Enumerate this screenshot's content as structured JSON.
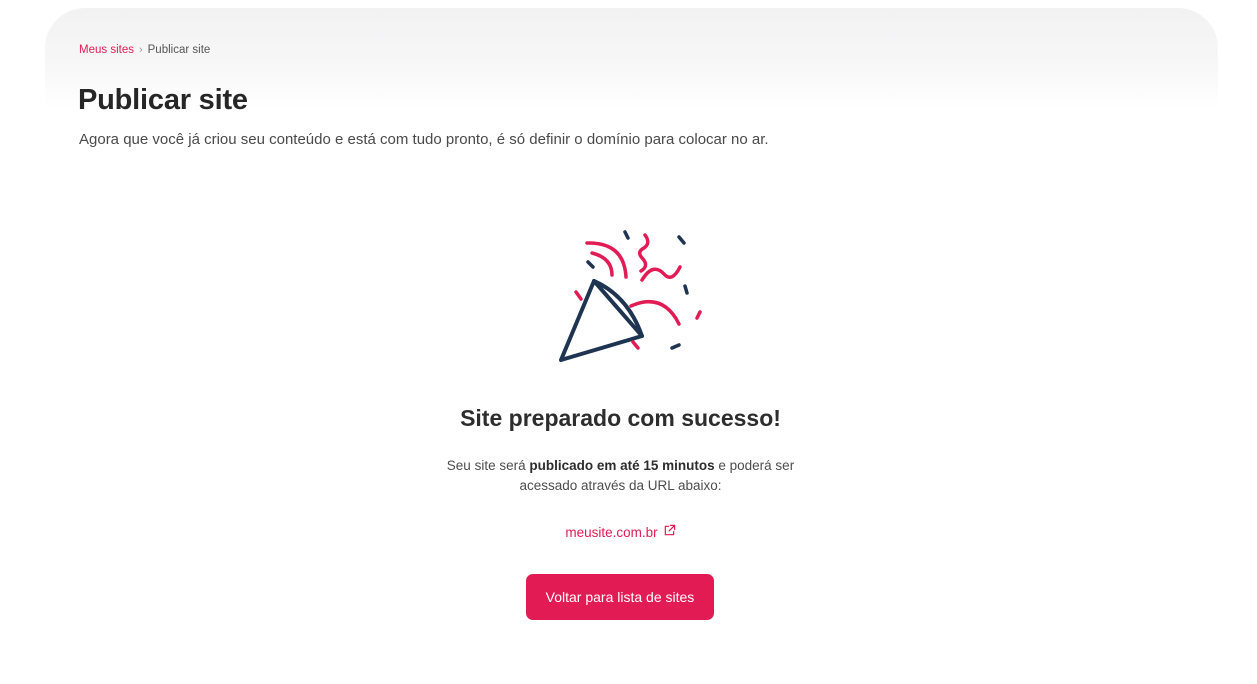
{
  "breadcrumb": {
    "parent": "Meus sites",
    "separator": "›",
    "current": "Publicar site"
  },
  "page": {
    "title": "Publicar site",
    "subtitle": "Agora que você já criou seu conteúdo e está com tudo pronto, é só definir o domínio para colocar no ar."
  },
  "illustration": {
    "icon": "party-popper-icon",
    "colors": {
      "primary": "#e31b54",
      "outline": "#1f3450"
    }
  },
  "success": {
    "title": "Site preparado com sucesso!",
    "text_before": "Seu site será ",
    "text_bold": "publicado em até 15 minutos",
    "text_after_line1": " e poderá ser",
    "text_line2": "acessado através da URL abaixo:"
  },
  "site_link": {
    "url_label": "meusite.com.br",
    "icon": "external-link-icon"
  },
  "actions": {
    "back_label": "Voltar para lista de sites"
  },
  "colors": {
    "accent": "#e31b54",
    "text": "#2d2d2d"
  }
}
